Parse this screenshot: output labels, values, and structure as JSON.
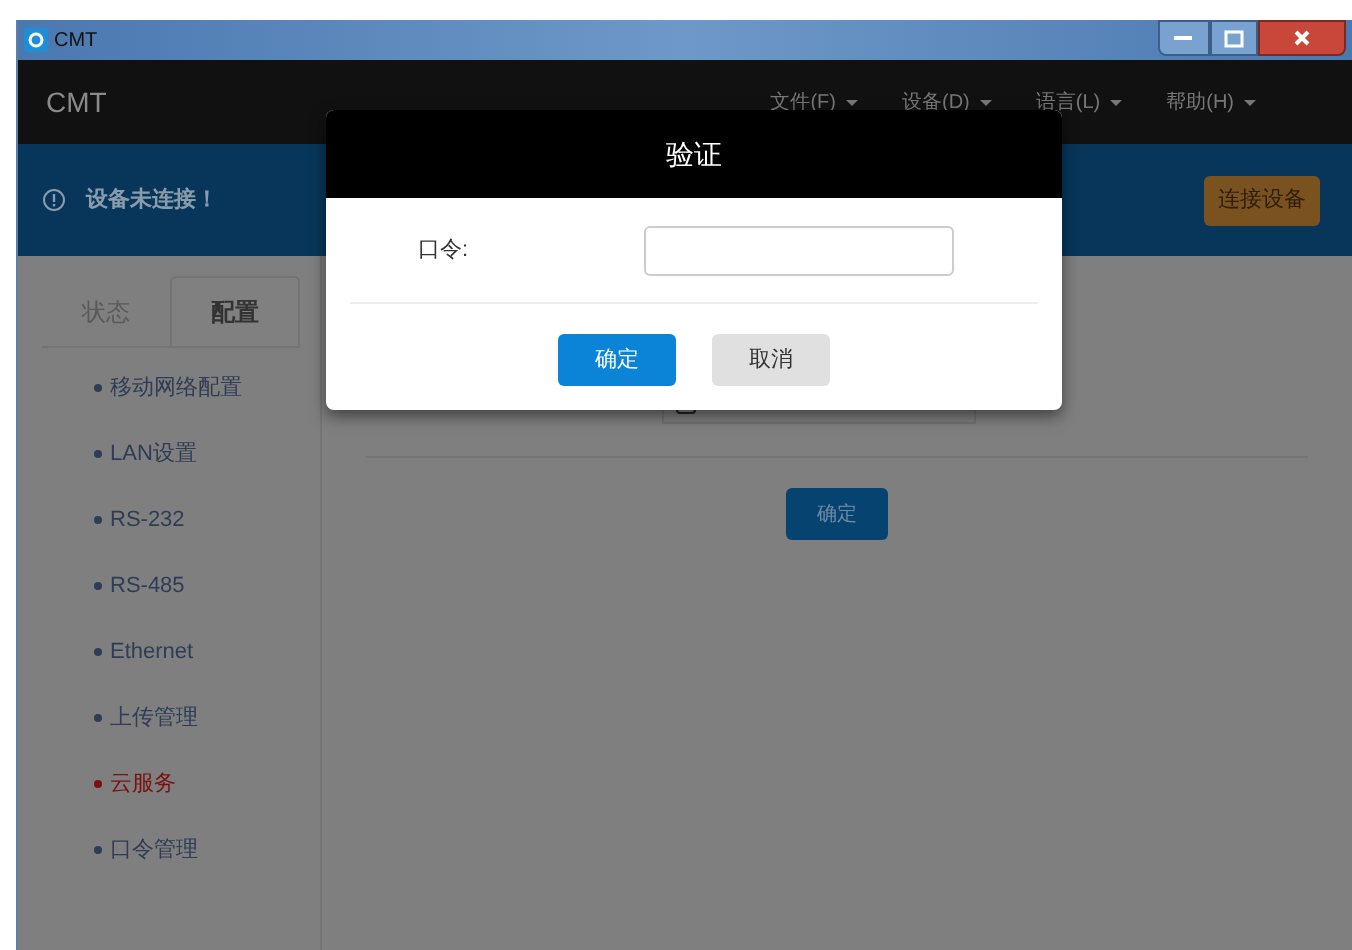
{
  "window": {
    "title": "CMT"
  },
  "navbar": {
    "brand": "CMT",
    "menus": [
      {
        "label": "文件(F)"
      },
      {
        "label": "设备(D)"
      },
      {
        "label": "语言(L)"
      },
      {
        "label": "帮助(H)"
      }
    ]
  },
  "alert": {
    "message": "设备未连接！",
    "button": "连接设备"
  },
  "sidebar": {
    "tabs": [
      {
        "label": "状态",
        "selected": false
      },
      {
        "label": "配置",
        "selected": true
      }
    ],
    "items": [
      {
        "label": "移动网络配置",
        "selected": false
      },
      {
        "label": "LAN设置",
        "selected": false
      },
      {
        "label": "RS-232",
        "selected": false
      },
      {
        "label": "RS-485",
        "selected": false
      },
      {
        "label": "Ethernet",
        "selected": false
      },
      {
        "label": "上传管理",
        "selected": false
      },
      {
        "label": "云服务",
        "selected": true
      },
      {
        "label": "口令管理",
        "selected": false
      }
    ]
  },
  "content": {
    "checkbox": {
      "checked": false
    },
    "confirm_button": "确定"
  },
  "dialog": {
    "title": "验证",
    "field_label": "口令:",
    "buttons": [
      {
        "label": "确定",
        "kind": "primary"
      },
      {
        "label": "取消",
        "kind": "secondary"
      }
    ]
  }
}
